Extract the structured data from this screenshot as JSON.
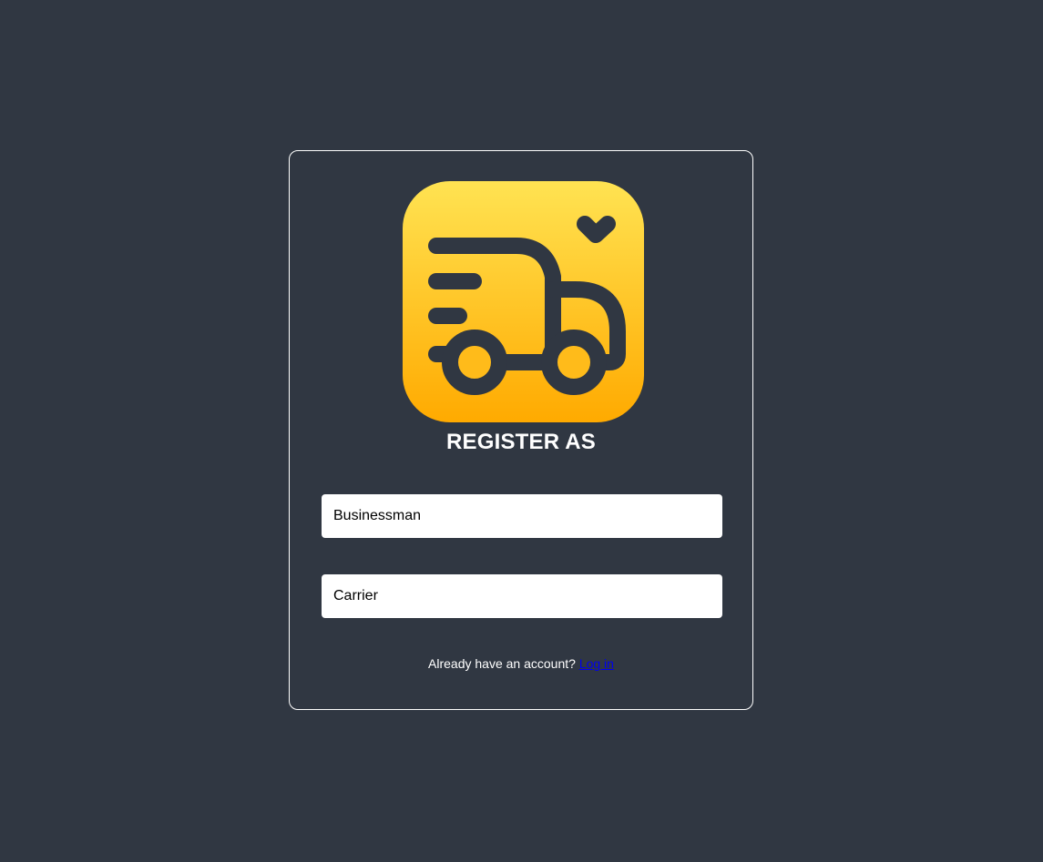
{
  "logo": {
    "icon": "delivery-truck-icon",
    "gradient_top": "#FFE352",
    "gradient_bottom": "#FFAA00",
    "stroke": "#303742"
  },
  "title": "REGISTER AS",
  "options": [
    {
      "label": "Businessman"
    },
    {
      "label": "Carrier"
    }
  ],
  "footer": {
    "prompt": "Already have an account?",
    "link": "Log in"
  },
  "colors": {
    "background": "#303742",
    "card_border": "#ffffff",
    "link": "#0000ee"
  }
}
